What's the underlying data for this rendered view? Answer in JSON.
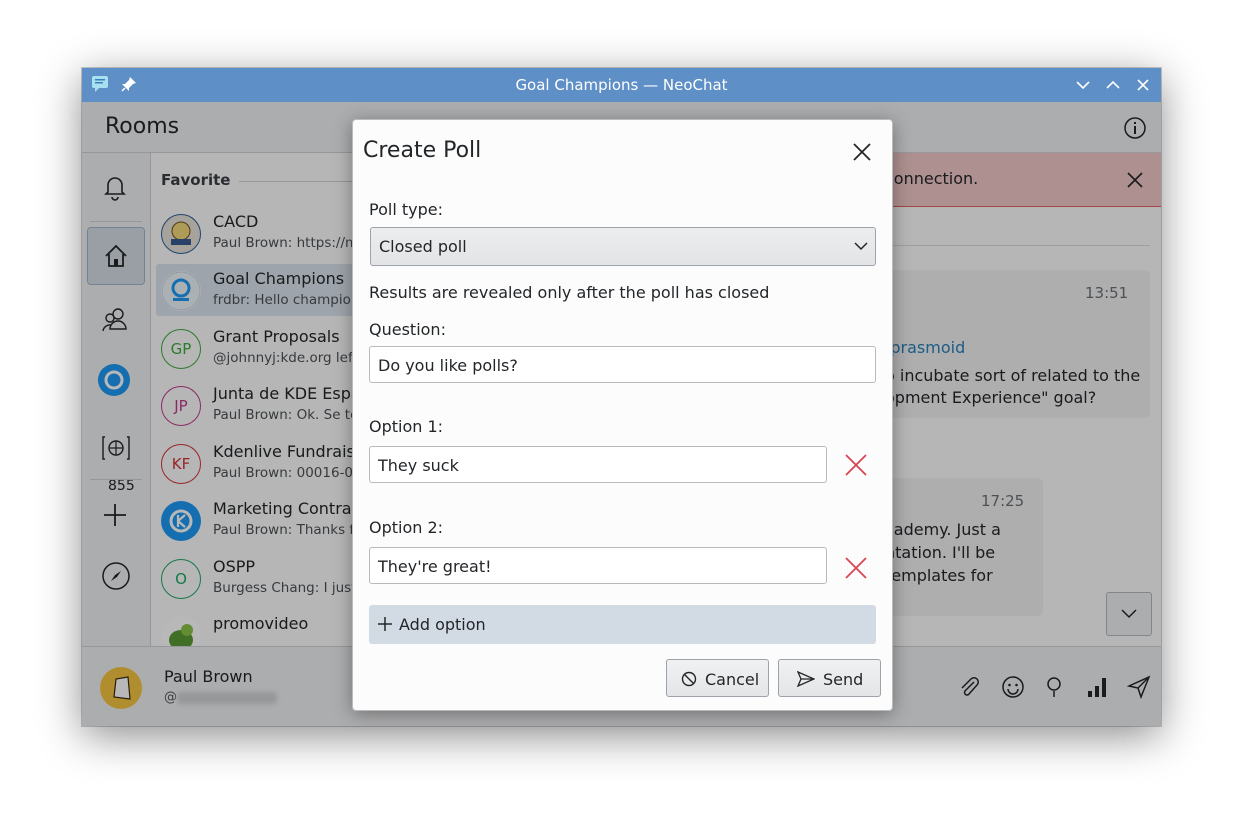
{
  "window": {
    "title": "Goal Champions — NeoChat"
  },
  "rooms": {
    "header": "Rooms",
    "section": "Favorite",
    "list": [
      {
        "name": "CACD",
        "preview": "Paul Brown: https://m"
      },
      {
        "name": "Goal Champions",
        "preview": "frdbr: Hello champion"
      },
      {
        "name": "Grant Proposals",
        "preview": "@johnnyj:kde.org left",
        "initials": "GP",
        "color": "#3daa3d"
      },
      {
        "name": "Junta de KDE Espa",
        "preview": "Paul Brown: Ok. Se te",
        "initials": "JP",
        "color": "#c0398b"
      },
      {
        "name": "Kdenlive Fundraisi",
        "preview": "Paul Brown: 00016-00",
        "initials": "KF",
        "color": "#d0343b"
      },
      {
        "name": "Marketing Contrac",
        "preview": "Paul Brown: Thanks fo"
      },
      {
        "name": "OSPP",
        "preview": "Burgess Chang: I just",
        "initials": "O",
        "color": "#1ea866"
      },
      {
        "name": "promovideo",
        "preview": ""
      }
    ],
    "badge": "855"
  },
  "user": {
    "name": "Paul Brown",
    "id_prefix": "@"
  },
  "chat": {
    "alert": "connection.",
    "msg1": {
      "time": "13:51",
      "link": "/prasmoid",
      "line1": "o incubate sort of related to the",
      "line2": "opment Experience\" goal?"
    },
    "msg2": {
      "time": "17:25",
      "line1": "cademy. Just a",
      "line2": "ntation. I'll be",
      "line3": "templates for"
    }
  },
  "dialog": {
    "title": "Create Poll",
    "poll_type_label": "Poll type:",
    "poll_type_value": "Closed poll",
    "poll_type_hint": "Results are revealed only after the poll has closed",
    "question_label": "Question:",
    "question_value": "Do you like polls?",
    "options": [
      {
        "label": "Option 1:",
        "value": "They suck"
      },
      {
        "label": "Option 2:",
        "value": "They're great!"
      }
    ],
    "add_option": "Add option",
    "cancel": "Cancel",
    "send": "Send"
  }
}
